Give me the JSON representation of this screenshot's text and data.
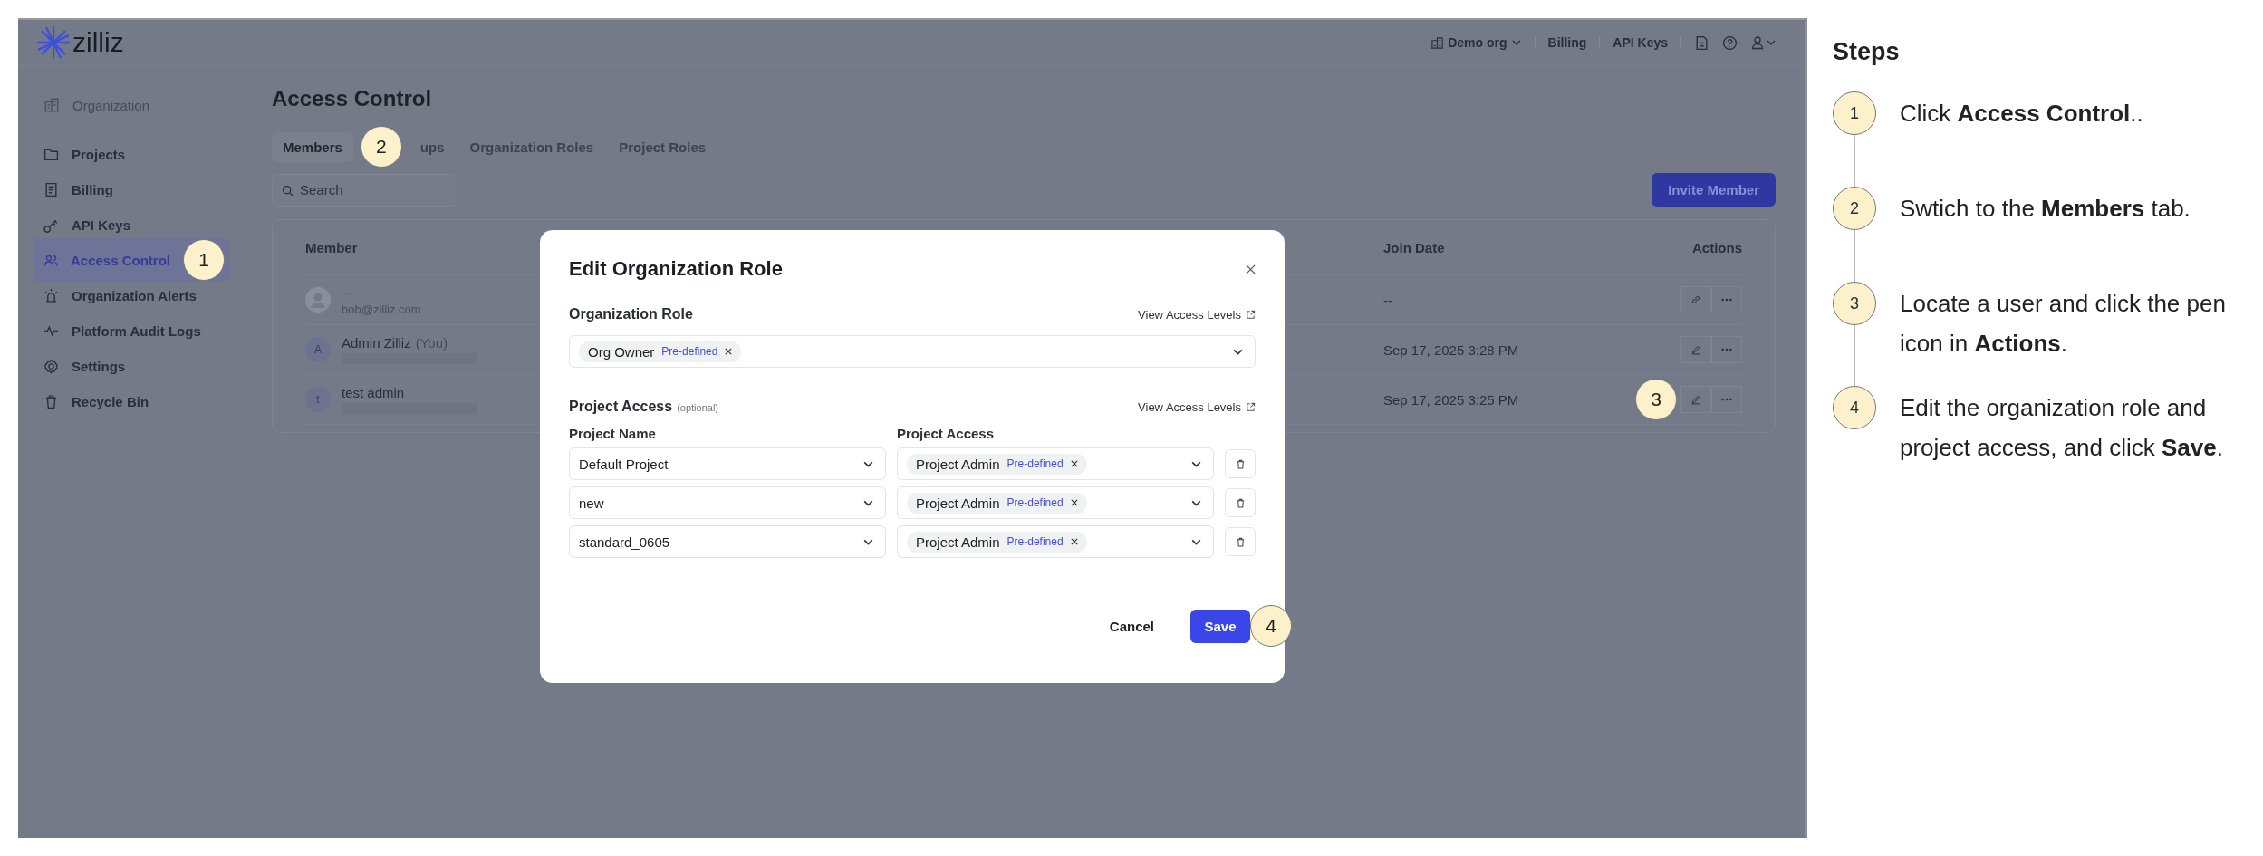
{
  "header": {
    "logo": "zilliz",
    "org": "Demo org",
    "links": [
      "Billing",
      "API Keys"
    ]
  },
  "sidebar": {
    "section": "Organization",
    "items": [
      {
        "label": "Projects",
        "selected": false
      },
      {
        "label": "Billing",
        "selected": false
      },
      {
        "label": "API Keys",
        "selected": false
      },
      {
        "label": "Access Control",
        "selected": true
      },
      {
        "label": "Organization Alerts",
        "selected": false
      },
      {
        "label": "Platform Audit Logs",
        "selected": false
      },
      {
        "label": "Settings",
        "selected": false
      },
      {
        "label": "Recycle Bin",
        "selected": false
      }
    ]
  },
  "page": {
    "title": "Access Control",
    "tabs": [
      {
        "label": "Members",
        "selected": true
      },
      {
        "label": "ups",
        "selected": false
      },
      {
        "label": "Organization Roles",
        "selected": false
      },
      {
        "label": "Project Roles",
        "selected": false
      }
    ],
    "search": {
      "placeholder": "Search"
    },
    "invite_button": "Invite Member"
  },
  "table": {
    "columns": [
      "Member",
      "Join Date",
      "Actions"
    ],
    "rows": [
      {
        "avatar": "",
        "name": "--",
        "suffix": "",
        "email": "bob@zilliz.com",
        "redacted": false,
        "join_date": "--",
        "kind": "link"
      },
      {
        "avatar": "A",
        "name": "Admin Zilliz",
        "suffix": "(You)",
        "email": "",
        "redacted": true,
        "join_date": "Sep 17, 2025 3:28 PM",
        "kind": "edit"
      },
      {
        "avatar": "t",
        "name": "test admin",
        "suffix": "",
        "email": "",
        "redacted": true,
        "join_date": "Sep 17, 2025 3:25 PM",
        "kind": "edit"
      }
    ]
  },
  "modal": {
    "title": "Edit Organization Role",
    "org_role": {
      "label": "Organization Role",
      "link": "View Access Levels",
      "chip": "Org Owner",
      "tag": "Pre-defined"
    },
    "project_access": {
      "label": "Project Access",
      "note": "(optional)",
      "link": "View Access Levels",
      "columns": [
        "Project Name",
        "Project Access"
      ],
      "rows": [
        {
          "project": "Default Project",
          "access": "Project Admin",
          "tag": "Pre-defined"
        },
        {
          "project": "new",
          "access": "Project Admin",
          "tag": "Pre-defined"
        },
        {
          "project": "standard_0605",
          "access": "Project Admin",
          "tag": "Pre-defined"
        }
      ]
    },
    "cancel": "Cancel",
    "save": "Save"
  },
  "callouts": [
    "1",
    "2",
    "3",
    "4"
  ],
  "steps": {
    "title": "Steps",
    "items": [
      {
        "number": "1",
        "text": "Click **Access Control**.."
      },
      {
        "number": "2",
        "text": "Swtich to the **Members** tab."
      },
      {
        "number": "3",
        "text": "Locate a user and click the pen icon in **Actions**."
      },
      {
        "number": "4",
        "text": "Edit the organization role and project access, and click **Save**."
      }
    ]
  }
}
